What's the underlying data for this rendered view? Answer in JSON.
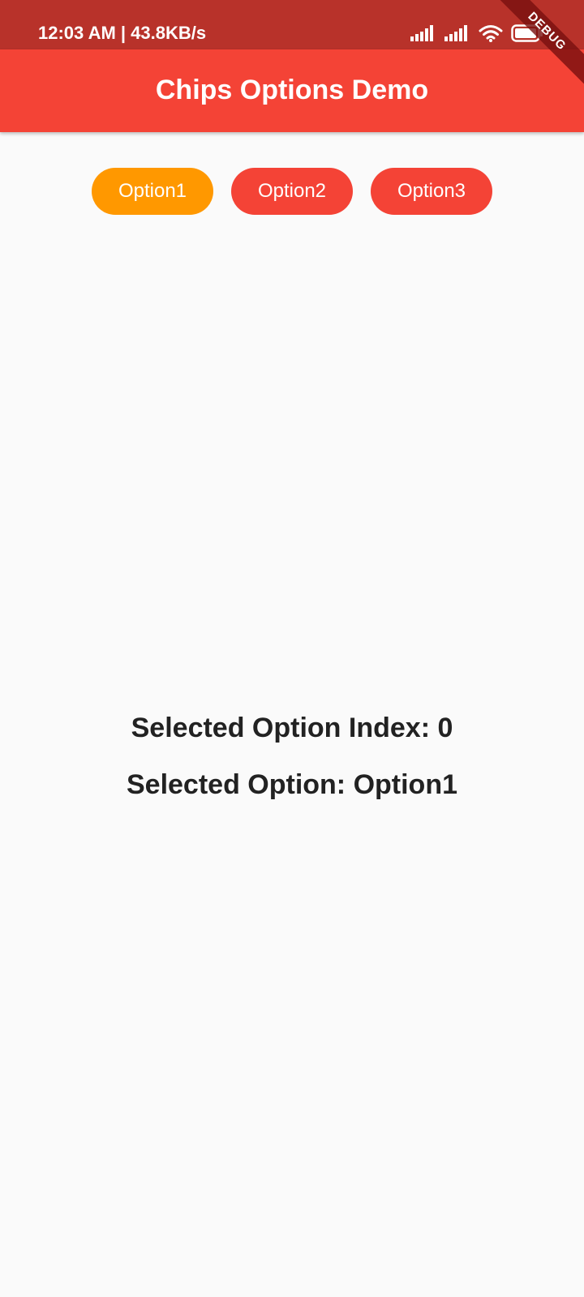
{
  "status_bar": {
    "text": "12:03 AM | 43.8KB/s",
    "icons": [
      "signal-icon",
      "signal-icon",
      "wifi-icon",
      "battery-icon"
    ]
  },
  "debug_banner": "DEBUG",
  "app_bar": {
    "title": "Chips Options Demo",
    "color": "#f44336"
  },
  "chips": [
    {
      "label": "Option1",
      "selected": true,
      "color": "#ff9800"
    },
    {
      "label": "Option2",
      "selected": false,
      "color": "#f44336"
    },
    {
      "label": "Option3",
      "selected": false,
      "color": "#f44336"
    }
  ],
  "result": {
    "index_text": "Selected Option Index: 0",
    "option_text": "Selected Option: Option1"
  }
}
